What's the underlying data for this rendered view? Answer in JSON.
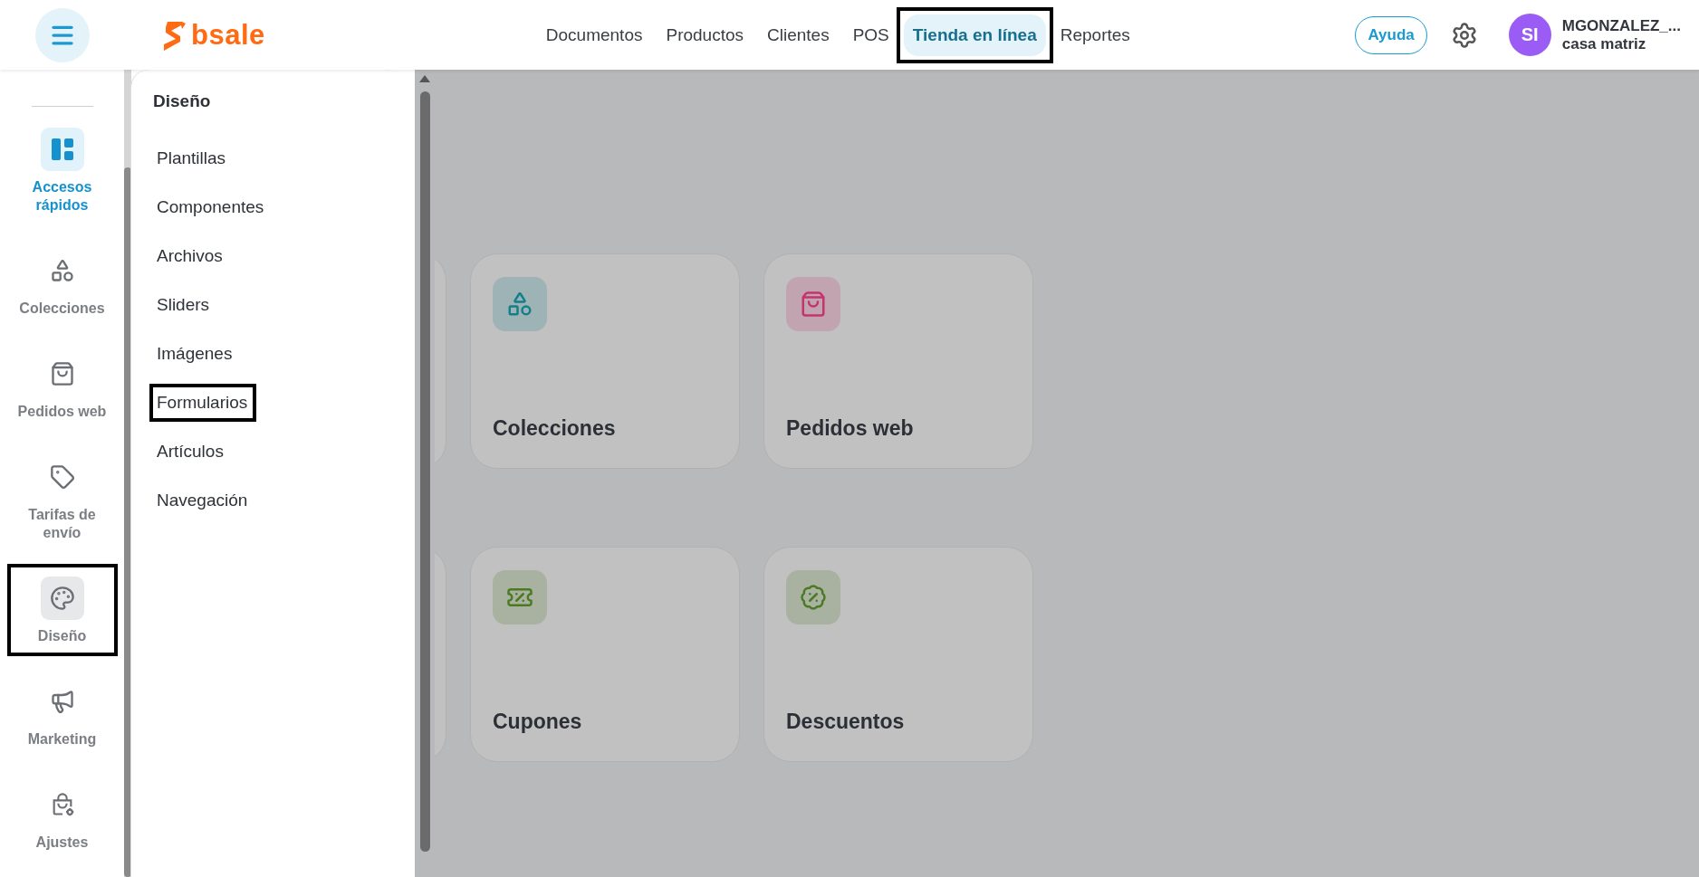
{
  "header": {
    "brand": "bsale",
    "nav": [
      {
        "label": "Documentos",
        "selected": false,
        "highlighted": false
      },
      {
        "label": "Productos",
        "selected": false,
        "highlighted": false
      },
      {
        "label": "Clientes",
        "selected": false,
        "highlighted": false
      },
      {
        "label": "POS",
        "selected": false,
        "highlighted": false
      },
      {
        "label": "Tienda en línea",
        "selected": true,
        "highlighted": true
      },
      {
        "label": "Reportes",
        "selected": false,
        "highlighted": false
      }
    ],
    "help_button": "Ayuda",
    "user": {
      "initials": "SI",
      "name": "MGONZALEZ_...",
      "branch": "casa matriz"
    }
  },
  "sidebar": {
    "items": [
      {
        "label": "Accesos rápidos",
        "selected": true,
        "expanded": false,
        "highlighted": false
      },
      {
        "label": "Colecciones",
        "selected": false,
        "expanded": false,
        "highlighted": false
      },
      {
        "label": "Pedidos web",
        "selected": false,
        "expanded": false,
        "highlighted": false
      },
      {
        "label": "Tarifas de envío",
        "selected": false,
        "expanded": false,
        "highlighted": false
      },
      {
        "label": "Diseño",
        "selected": false,
        "expanded": true,
        "highlighted": true
      },
      {
        "label": "Marketing",
        "selected": false,
        "expanded": false,
        "highlighted": false
      },
      {
        "label": "Ajustes",
        "selected": false,
        "expanded": false,
        "highlighted": false
      }
    ]
  },
  "submenu": {
    "title": "Diseño",
    "items": [
      {
        "label": "Plantillas",
        "highlighted": false
      },
      {
        "label": "Componentes",
        "highlighted": false
      },
      {
        "label": "Archivos",
        "highlighted": false
      },
      {
        "label": "Sliders",
        "highlighted": false
      },
      {
        "label": "Imágenes",
        "highlighted": false
      },
      {
        "label": "Formularios",
        "highlighted": true
      },
      {
        "label": "Artículos",
        "highlighted": false
      },
      {
        "label": "Navegación",
        "highlighted": false
      }
    ]
  },
  "cards": [
    {
      "title": "Colecciones",
      "color": "#137f89"
    },
    {
      "title": "Pedidos web",
      "color": "#c3346f"
    },
    {
      "title": "Cupones",
      "color": "#4b7a22"
    },
    {
      "title": "Descuentos",
      "color": "#4b7a22"
    }
  ]
}
